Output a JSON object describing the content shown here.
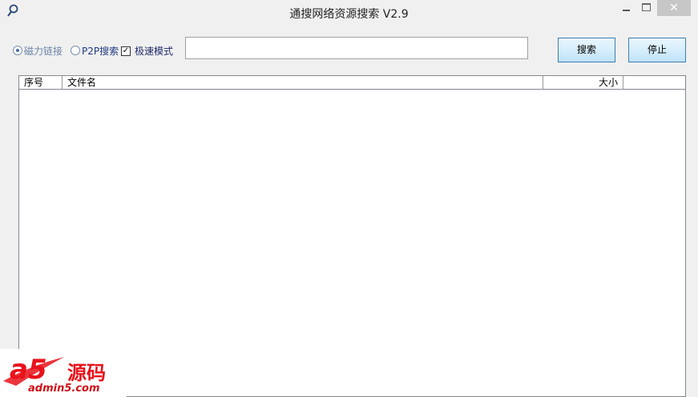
{
  "window": {
    "title": "通搜网络资源搜索 V2.9",
    "app_icon": "search-icon",
    "close_glyph": "✕"
  },
  "options": {
    "magnet_label": "磁力链接",
    "magnet_selected": true,
    "p2p_label": "P2P搜索",
    "p2p_selected": false,
    "fast_mode_label": "极速模式",
    "fast_mode_checked": true,
    "check_glyph": "✓"
  },
  "search": {
    "value": "",
    "search_button": "搜索",
    "stop_button": "停止"
  },
  "results": {
    "columns": [
      "序号",
      "文件名",
      "大小"
    ],
    "rows": []
  },
  "watermark": {
    "brand": "a5",
    "text": "源码",
    "url": "admin5.com",
    "color": "#e8121b"
  }
}
